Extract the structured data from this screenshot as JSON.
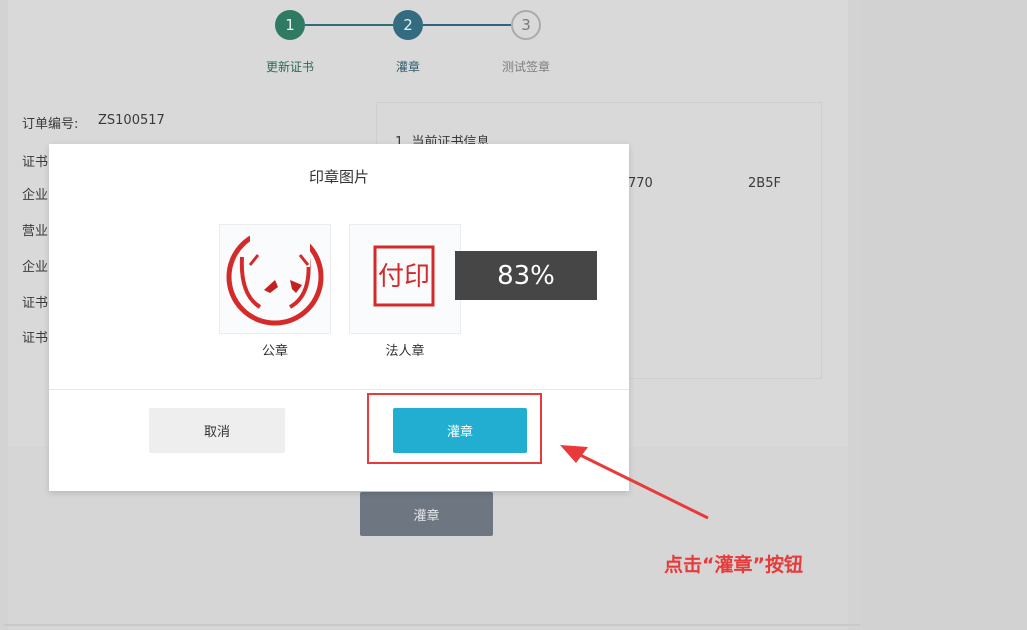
{
  "steps": [
    {
      "number": "1",
      "label": "更新证书"
    },
    {
      "number": "2",
      "label": "灌章"
    },
    {
      "number": "3",
      "label": "测试签章"
    }
  ],
  "order": {
    "label": "订单编号:",
    "value": "ZS100517"
  },
  "info_labels": [
    "证书",
    "企业",
    "营业",
    "企业",
    "证书",
    "证书"
  ],
  "info_box": {
    "heading": "1. 当前证书信息",
    "hex_left": "770",
    "hex_right": "2B5F"
  },
  "background_button": "灌章",
  "modal": {
    "title": "印章图片",
    "seals": [
      {
        "caption": "公章"
      },
      {
        "caption": "法人章",
        "seal_text": "付印"
      }
    ],
    "progress": "83%",
    "cancel_label": "取消",
    "apply_label": "灌章"
  },
  "annotation": {
    "text": "点击“灌章”按钮",
    "color": "#e83a3a"
  },
  "colors": {
    "step_done": "#2e7a63",
    "step_active": "#336b80",
    "primary_button": "#21aed0",
    "highlight": "#e83a3a"
  }
}
